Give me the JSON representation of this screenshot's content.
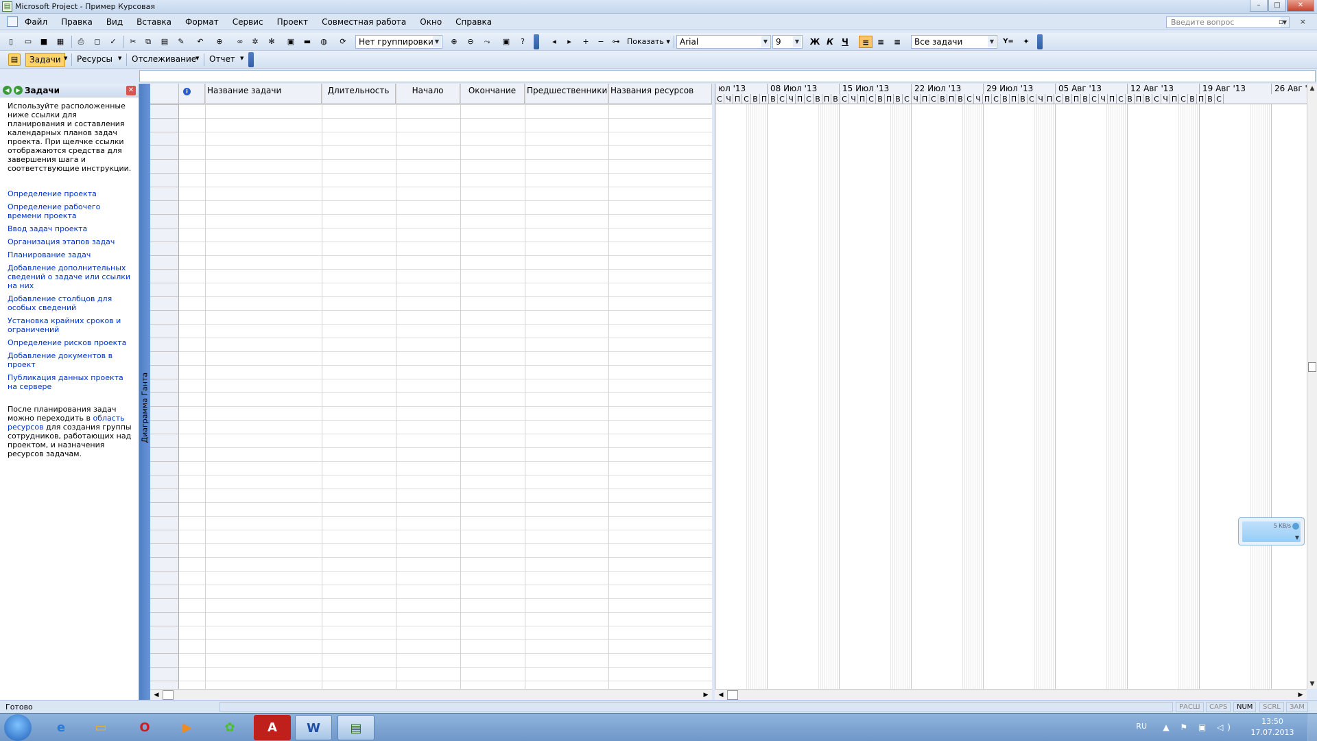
{
  "window": {
    "title": "Microsoft Project - Пример Курсовая",
    "controls": [
      "–",
      "□",
      "✕"
    ]
  },
  "menu": {
    "items": [
      "Файл",
      "Правка",
      "Вид",
      "Вставка",
      "Формат",
      "Сервис",
      "Проект",
      "Совместная работа",
      "Окно",
      "Справка"
    ],
    "help_placeholder": "Введите вопрос",
    "mdi_controls": "▫ ×"
  },
  "toolbar": {
    "grouping": "Нет группировки",
    "show_label": "Показать",
    "font_name": "Arial",
    "font_size": "9",
    "bold": "Ж",
    "italic": "К",
    "underline": "Ч",
    "filter": "Все задачи",
    "filter_icon": "Y="
  },
  "view_toolbar": {
    "tasks": "Задачи",
    "resources": "Ресурсы",
    "tracking": "Отслеживание",
    "report": "Отчет"
  },
  "side_pane": {
    "title": "Задачи",
    "intro": "Используйте расположенные ниже ссылки для планирования и составления календарных планов задач проекта. При щелчке ссылки отображаются средства для завершения шага и соответствующие инструкции.",
    "links": [
      "Определение проекта",
      "Определение рабочего времени проекта",
      "Ввод задач проекта",
      "Организация этапов задач",
      "Планирование задач",
      "Добавление дополнительных сведений о задаче или ссылки на них",
      "Добавление столбцов для особых сведений",
      "Установка крайних сроков и ограничений",
      "Определение рисков проекта",
      "Добавление документов в проект",
      "Публикация данных проекта на сервере"
    ],
    "after_1": "После планирования задач можно переходить в ",
    "after_link": "область ресурсов",
    "after_2": " для создания группы сотрудников, работающих над проектом, и назначения ресурсов задачам."
  },
  "view_bar": {
    "label": "Диаграмма Ганта"
  },
  "table": {
    "columns": [
      "Название задачи",
      "Длительность",
      "Начало",
      "Окончание",
      "Предшественники",
      "Названия ресурсов"
    ]
  },
  "gantt": {
    "weeks": [
      "юл '13",
      "08 Июл '13",
      "15 Июл '13",
      "22 Июл '13",
      "29 Июл '13",
      "05 Авг '13",
      "12 Авг '13",
      "19 Авг '13",
      "26 Авг '1"
    ],
    "first_days": [
      "С",
      "Ч",
      "П",
      "С",
      "В"
    ],
    "week_days": [
      "П",
      "В",
      "С",
      "Ч",
      "П",
      "С",
      "В"
    ],
    "last_days": [
      "П",
      "В",
      "С"
    ]
  },
  "netmeter": {
    "speed": "5 KB/s"
  },
  "status": {
    "ready": "Готово",
    "indicators": [
      {
        "label": "РАСШ",
        "on": false
      },
      {
        "label": "CAPS",
        "on": false
      },
      {
        "label": "NUM",
        "on": true
      },
      {
        "label": "SCRL",
        "on": false
      },
      {
        "label": "ЗАМ",
        "on": false
      }
    ]
  },
  "taskbar": {
    "lang": "RU",
    "time": "13:50",
    "date": "17.07.2013",
    "tray_icons": "▲ ⚑ ▣ ◁)"
  },
  "colors": {
    "accent": "#4e7ec4",
    "link": "#0033cc",
    "active_tab": "#ffd56b"
  }
}
